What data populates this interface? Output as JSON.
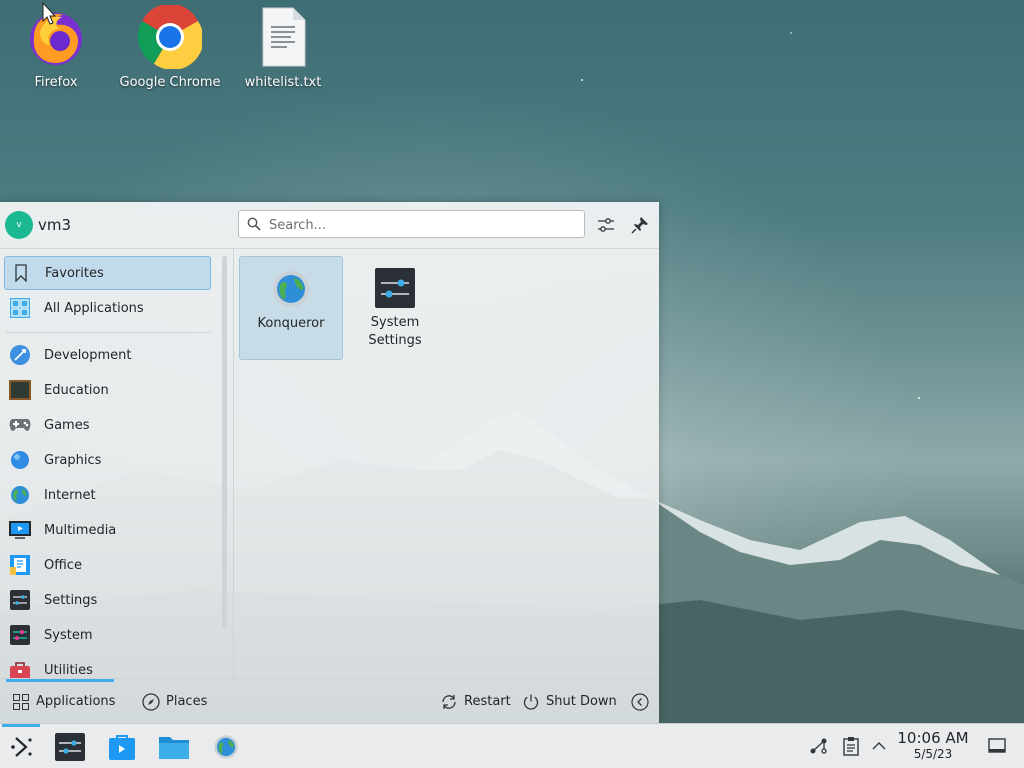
{
  "desktop": {
    "icons": [
      {
        "label": "Firefox",
        "icon": "firefox-icon"
      },
      {
        "label": "Google Chrome",
        "icon": "chrome-icon"
      },
      {
        "label": "whitelist.txt",
        "icon": "text-file-icon"
      }
    ]
  },
  "launcher": {
    "user": {
      "name": "vm3",
      "initial": "v"
    },
    "search": {
      "placeholder": "Search...",
      "value": ""
    },
    "header_buttons": [
      {
        "icon": "configure-icon"
      },
      {
        "icon": "pin-icon"
      }
    ],
    "categories": [
      {
        "label": "Favorites",
        "icon": "bookmark-icon",
        "active": true
      },
      {
        "label": "All Applications",
        "icon": "grid-icon",
        "active": false
      },
      {
        "label": "Development",
        "icon": "development-icon",
        "active": false
      },
      {
        "label": "Education",
        "icon": "education-icon",
        "active": false
      },
      {
        "label": "Games",
        "icon": "gamepad-icon",
        "active": false
      },
      {
        "label": "Graphics",
        "icon": "graphics-icon",
        "active": false
      },
      {
        "label": "Internet",
        "icon": "globe-icon",
        "active": false
      },
      {
        "label": "Multimedia",
        "icon": "multimedia-icon",
        "active": false
      },
      {
        "label": "Office",
        "icon": "office-icon",
        "active": false
      },
      {
        "label": "Settings",
        "icon": "settings-icon",
        "active": false
      },
      {
        "label": "System",
        "icon": "system-icon",
        "active": false
      },
      {
        "label": "Utilities",
        "icon": "utilities-icon",
        "active": false
      }
    ],
    "favorites": [
      {
        "label": "Konqueror",
        "icon": "konqueror-icon"
      },
      {
        "label_line1": "System",
        "label_line2": "Settings",
        "icon": "system-settings-icon"
      }
    ],
    "footer": {
      "tabs": [
        {
          "label": "Applications",
          "icon": "applications-grid-icon",
          "active": true
        },
        {
          "label": "Places",
          "icon": "compass-icon",
          "active": false
        }
      ],
      "actions": [
        {
          "label": "Restart",
          "icon": "restart-icon"
        },
        {
          "label": "Shut Down",
          "icon": "power-icon"
        }
      ],
      "more_icon": "chevron-left-icon"
    }
  },
  "taskbar": {
    "launcher_icon": "kde-launcher-icon",
    "tasks": [
      {
        "icon": "system-settings-icon"
      },
      {
        "icon": "discover-icon"
      },
      {
        "icon": "file-manager-icon"
      },
      {
        "icon": "konqueror-icon"
      }
    ],
    "tray": [
      {
        "icon": "network-icon"
      },
      {
        "icon": "clipboard-icon"
      },
      {
        "icon": "chevron-up-icon"
      }
    ],
    "clock": {
      "time": "10:06 AM",
      "date": "5/5/23"
    },
    "show_desktop_icon": "show-desktop-icon"
  },
  "colors": {
    "accent": "#3daee9",
    "selection": "#c2dbec",
    "avatar": "#1cb892"
  }
}
